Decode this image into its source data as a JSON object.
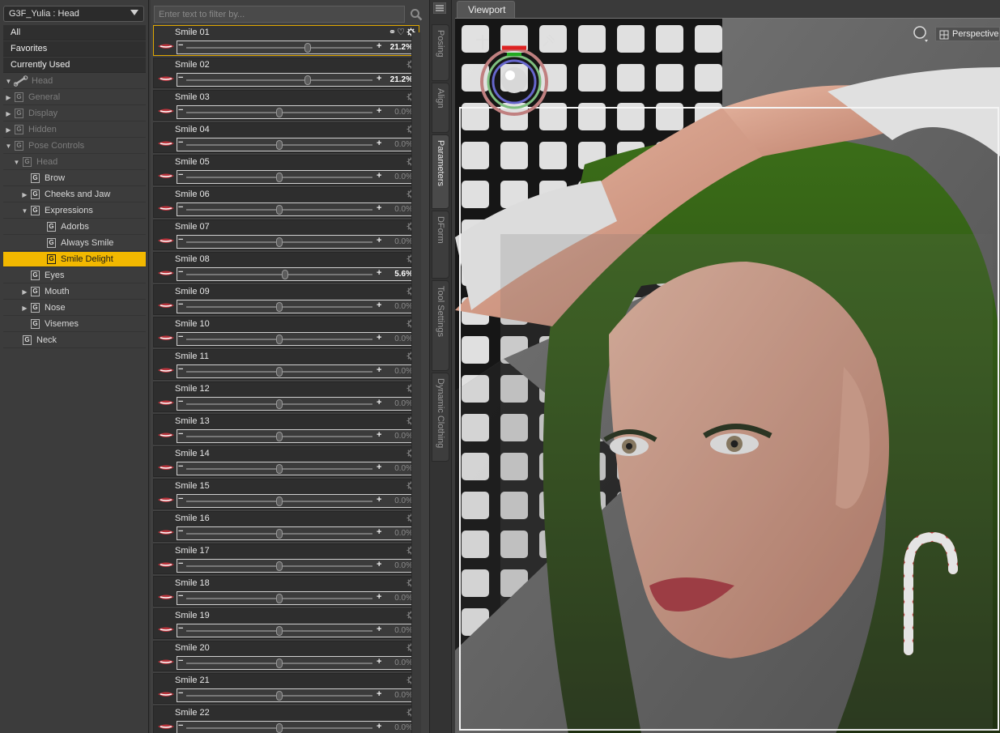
{
  "tree": {
    "node_select": "G3F_Yulia : Head",
    "categories": [
      "All",
      "Favorites",
      "Currently Used"
    ],
    "root_label": "Head",
    "items": [
      {
        "label": "General",
        "dim": true,
        "indent": 1,
        "exp": "▶"
      },
      {
        "label": "Display",
        "dim": true,
        "indent": 1,
        "exp": "▶"
      },
      {
        "label": "Hidden",
        "dim": true,
        "indent": 1,
        "exp": "▶"
      },
      {
        "label": "Pose Controls",
        "dim": true,
        "indent": 1,
        "exp": "▼"
      },
      {
        "label": "Head",
        "dim": true,
        "indent": 2,
        "exp": "▼"
      },
      {
        "label": "Brow",
        "dim": false,
        "indent": 3,
        "exp": ""
      },
      {
        "label": "Cheeks and Jaw",
        "dim": false,
        "indent": 3,
        "exp": "▶"
      },
      {
        "label": "Expressions",
        "dim": false,
        "indent": 3,
        "exp": "▼"
      },
      {
        "label": "Adorbs",
        "dim": false,
        "indent": 4,
        "exp": ""
      },
      {
        "label": "Always Smile",
        "dim": false,
        "indent": 4,
        "exp": ""
      },
      {
        "label": "Smile Delight",
        "dim": false,
        "indent": 4,
        "exp": "",
        "selected": true
      },
      {
        "label": "Eyes",
        "dim": false,
        "indent": 3,
        "exp": ""
      },
      {
        "label": "Mouth",
        "dim": false,
        "indent": 3,
        "exp": "▶"
      },
      {
        "label": "Nose",
        "dim": false,
        "indent": 3,
        "exp": "▶"
      },
      {
        "label": "Visemes",
        "dim": false,
        "indent": 3,
        "exp": ""
      },
      {
        "label": "Neck",
        "dim": false,
        "indent": 2,
        "exp": ""
      }
    ]
  },
  "filter": {
    "placeholder": "Enter text to filter by..."
  },
  "params": [
    {
      "name": "Smile 01",
      "value": "21.2%",
      "level": 0.65,
      "active": true
    },
    {
      "name": "Smile 02",
      "value": "21.2%",
      "level": 0.65
    },
    {
      "name": "Smile 03",
      "value": "0.0%",
      "level": 0.5
    },
    {
      "name": "Smile 04",
      "value": "0.0%",
      "level": 0.5
    },
    {
      "name": "Smile 05",
      "value": "0.0%",
      "level": 0.5
    },
    {
      "name": "Smile 06",
      "value": "0.0%",
      "level": 0.5
    },
    {
      "name": "Smile 07",
      "value": "0.0%",
      "level": 0.5
    },
    {
      "name": "Smile 08",
      "value": "5.6%",
      "level": 0.53
    },
    {
      "name": "Smile 09",
      "value": "0.0%",
      "level": 0.5
    },
    {
      "name": "Smile 10",
      "value": "0.0%",
      "level": 0.5
    },
    {
      "name": "Smile 11",
      "value": "0.0%",
      "level": 0.5
    },
    {
      "name": "Smile 12",
      "value": "0.0%",
      "level": 0.5
    },
    {
      "name": "Smile 13",
      "value": "0.0%",
      "level": 0.5
    },
    {
      "name": "Smile 14",
      "value": "0.0%",
      "level": 0.5
    },
    {
      "name": "Smile 15",
      "value": "0.0%",
      "level": 0.5
    },
    {
      "name": "Smile 16",
      "value": "0.0%",
      "level": 0.5
    },
    {
      "name": "Smile 17",
      "value": "0.0%",
      "level": 0.5
    },
    {
      "name": "Smile 18",
      "value": "0.0%",
      "level": 0.5
    },
    {
      "name": "Smile 19",
      "value": "0.0%",
      "level": 0.5
    },
    {
      "name": "Smile 20",
      "value": "0.0%",
      "level": 0.5
    },
    {
      "name": "Smile 21",
      "value": "0.0%",
      "level": 0.5
    },
    {
      "name": "Smile 22",
      "value": "0.0%",
      "level": 0.5
    }
  ],
  "side_tabs": [
    "Posing",
    "Align",
    "Parameters",
    "DForm",
    "Tool Settings",
    "Dynamic Clothing"
  ],
  "viewport": {
    "tab_label": "Viewport",
    "camera": "Perspective"
  },
  "colors": {
    "accent": "#f2b800",
    "panel": "#3c3c3c",
    "hair": "#2f5a12",
    "skin": "#d9a08a"
  }
}
